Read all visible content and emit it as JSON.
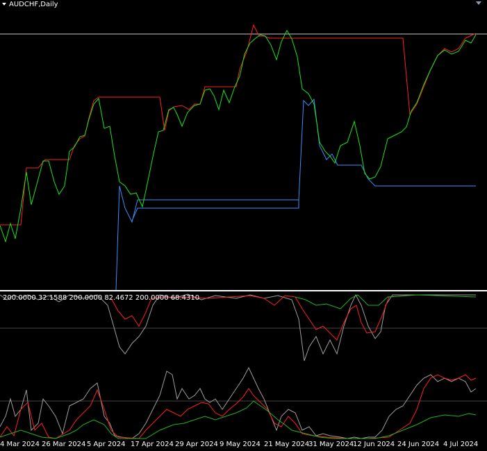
{
  "window": {
    "title": "AUDCHF,Daily"
  },
  "subwindow": {
    "indicator_values": "200.0000 32.1588 200.0000 82.4672 200.0000 68.4310"
  },
  "time_axis": {
    "labels": [
      "4 Mar 2024",
      "26 Mar 2024",
      "5 Apr 2024",
      "17 Apr 2024",
      "29 Apr 2024",
      "9 May 2024",
      "21 May 2024",
      "31 May 2024",
      "12 Jun 2024",
      "24 Jun 2024",
      "4 Jul 2024"
    ]
  },
  "colors": {
    "background": "#000000",
    "up_line": "#ff2020",
    "down_line": "#19e619",
    "stop_line": "#3a8fff",
    "level_line": "#c8c8c8",
    "osc_gray": "#a0a0a0",
    "osc_red": "#ff2020",
    "osc_green": "#1fb51f"
  },
  "chart_data": {
    "type": "line",
    "series": [],
    "x": [
      "4 Mar 2024",
      "26 Mar 2024",
      "5 Apr 2024",
      "17 Apr 2024",
      "29 Apr 2024",
      "9 May 2024",
      "21 May 2024",
      "31 May 2024",
      "12 Jun 2024",
      "24 Jun 2024",
      "4 Jul 2024"
    ],
    "grid": false
  }
}
